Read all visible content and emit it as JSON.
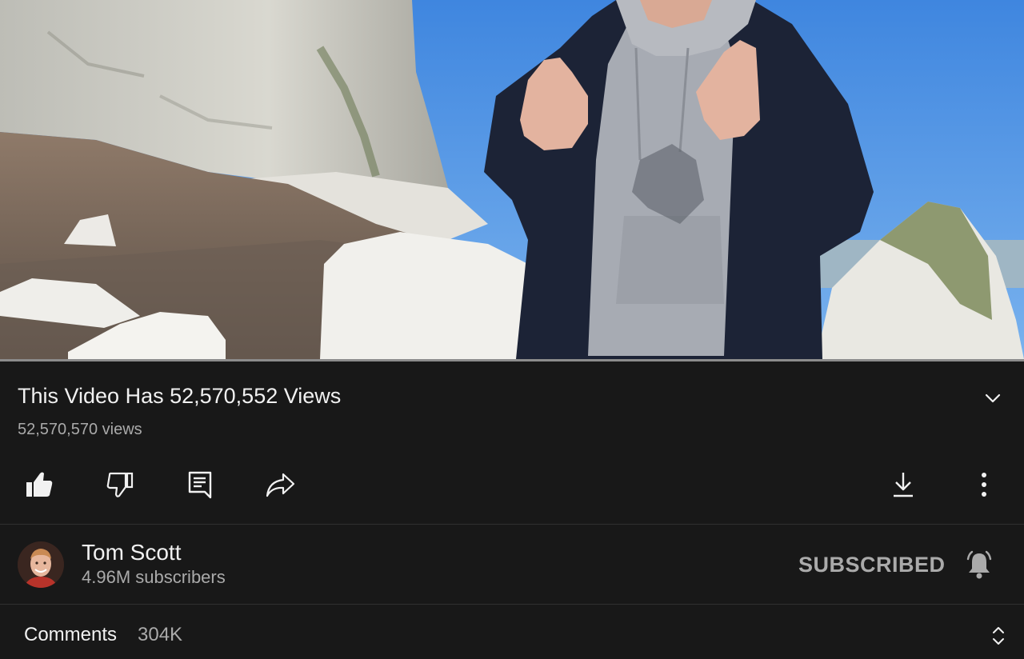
{
  "video": {
    "title": "This Video Has 52,570,552 Views",
    "views": "52,570,570 views",
    "progress_fraction": 1.0
  },
  "actions": {
    "like_icon": "thumbs-up-icon",
    "dislike_icon": "thumbs-down-icon",
    "comment_icon": "comment-icon",
    "share_icon": "share-arrow-icon",
    "download_icon": "download-icon",
    "more_icon": "more-vertical-icon"
  },
  "channel": {
    "name": "Tom Scott",
    "subscribers": "4.96M subscribers",
    "subscribe_label": "SUBSCRIBED",
    "bell_icon": "bell-icon"
  },
  "comments": {
    "label": "Comments",
    "count": "304K"
  },
  "colors": {
    "background": "#181818",
    "primary_text": "#f1f1f1",
    "secondary_text": "#aaaaaa",
    "divider": "#303030"
  }
}
